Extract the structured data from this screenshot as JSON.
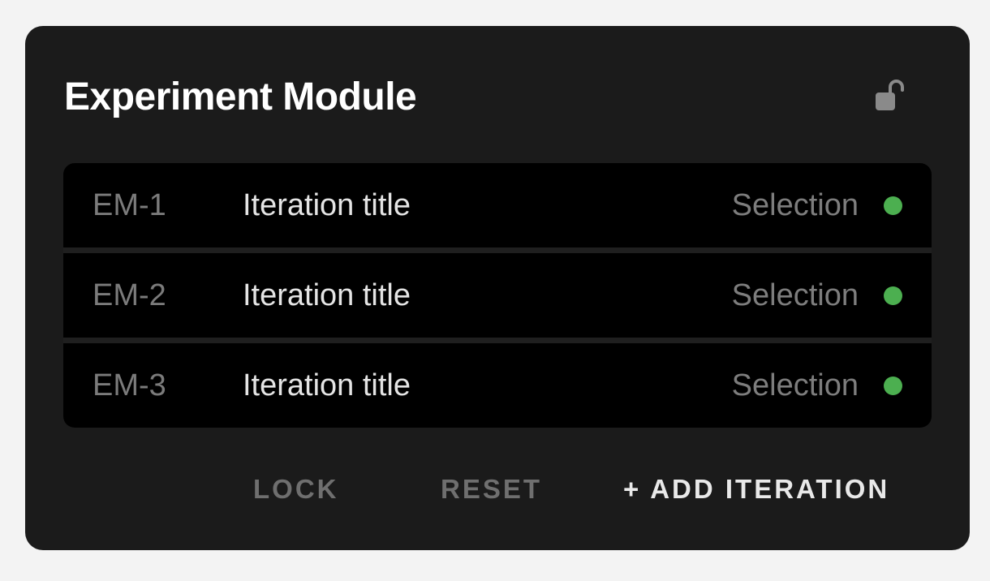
{
  "module": {
    "title": "Experiment Module",
    "lock_icon": "unlocked-padlock-icon"
  },
  "iterations": [
    {
      "id": "EM-1",
      "title": "Iteration title",
      "selection": "Selection",
      "status_color": "#4caf50"
    },
    {
      "id": "EM-2",
      "title": "Iteration title",
      "selection": "Selection",
      "status_color": "#4caf50"
    },
    {
      "id": "EM-3",
      "title": "Iteration title",
      "selection": "Selection",
      "status_color": "#4caf50"
    }
  ],
  "actions": {
    "lock_label": "LOCK",
    "reset_label": "RESET",
    "add_label": "+ ADD ITERATION"
  },
  "colors": {
    "background": "#f3f3f3",
    "card": "#1b1b1b",
    "row": "#000000",
    "status_green": "#4caf50"
  }
}
